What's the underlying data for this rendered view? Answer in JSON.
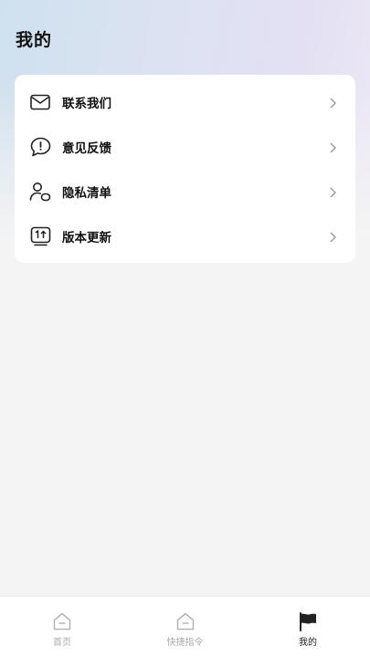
{
  "header": {
    "title": "我的"
  },
  "menu": {
    "items": [
      {
        "label": "联系我们",
        "icon": "mail-icon"
      },
      {
        "label": "意见反馈",
        "icon": "feedback-icon"
      },
      {
        "label": "隐私清单",
        "icon": "privacy-icon"
      },
      {
        "label": "版本更新",
        "icon": "update-icon"
      }
    ]
  },
  "tabs": [
    {
      "label": "首页",
      "icon": "home-icon",
      "active": false
    },
    {
      "label": "快捷指令",
      "icon": "shortcut-icon",
      "active": false
    },
    {
      "label": "我的",
      "icon": "flag-icon",
      "active": true
    }
  ],
  "colors": {
    "active_tab": "#222222",
    "inactive_tab": "#aaaaaa",
    "background": "#f4f4f4"
  }
}
